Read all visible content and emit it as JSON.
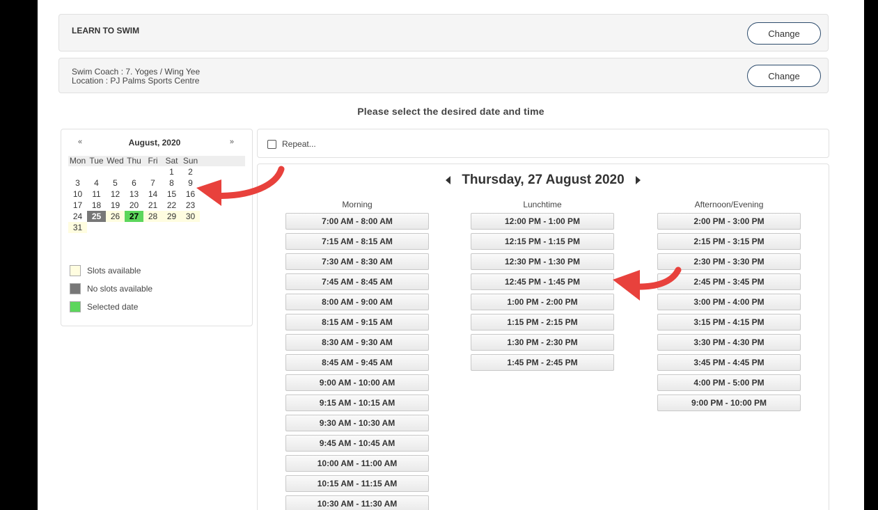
{
  "service": {
    "title": "LEARN TO SWIM",
    "change_label": "Change"
  },
  "coach": {
    "coach_line": "Swim Coach : 7. Yoges / Wing Yee",
    "location_line": "Location : PJ Palms Sports Centre",
    "change_label": "Change"
  },
  "prompt": "Please select the desired date and time",
  "calendar": {
    "prev": "«",
    "next": "»",
    "month": "August, 2020",
    "weekdays": [
      "Mon",
      "Tue",
      "Wed",
      "Thu",
      "Fri",
      "Sat",
      "Sun"
    ],
    "weeks": [
      [
        {
          "d": "",
          "s": ""
        },
        {
          "d": "",
          "s": ""
        },
        {
          "d": "",
          "s": ""
        },
        {
          "d": "",
          "s": ""
        },
        {
          "d": "",
          "s": ""
        },
        {
          "d": "1",
          "s": ""
        },
        {
          "d": "2",
          "s": ""
        }
      ],
      [
        {
          "d": "3",
          "s": ""
        },
        {
          "d": "4",
          "s": ""
        },
        {
          "d": "5",
          "s": ""
        },
        {
          "d": "6",
          "s": ""
        },
        {
          "d": "7",
          "s": ""
        },
        {
          "d": "8",
          "s": ""
        },
        {
          "d": "9",
          "s": ""
        }
      ],
      [
        {
          "d": "10",
          "s": ""
        },
        {
          "d": "11",
          "s": ""
        },
        {
          "d": "12",
          "s": ""
        },
        {
          "d": "13",
          "s": ""
        },
        {
          "d": "14",
          "s": ""
        },
        {
          "d": "15",
          "s": ""
        },
        {
          "d": "16",
          "s": ""
        }
      ],
      [
        {
          "d": "17",
          "s": ""
        },
        {
          "d": "18",
          "s": ""
        },
        {
          "d": "19",
          "s": ""
        },
        {
          "d": "20",
          "s": ""
        },
        {
          "d": "21",
          "s": ""
        },
        {
          "d": "22",
          "s": ""
        },
        {
          "d": "23",
          "s": ""
        }
      ],
      [
        {
          "d": "24",
          "s": ""
        },
        {
          "d": "25",
          "s": "none"
        },
        {
          "d": "26",
          "s": "avail"
        },
        {
          "d": "27",
          "s": "sel"
        },
        {
          "d": "28",
          "s": "avail"
        },
        {
          "d": "29",
          "s": "avail"
        },
        {
          "d": "30",
          "s": "avail"
        }
      ],
      [
        {
          "d": "31",
          "s": "avail"
        },
        {
          "d": "",
          "s": ""
        },
        {
          "d": "",
          "s": ""
        },
        {
          "d": "",
          "s": ""
        },
        {
          "d": "",
          "s": ""
        },
        {
          "d": "",
          "s": ""
        },
        {
          "d": "",
          "s": ""
        }
      ]
    ],
    "legend": [
      {
        "label": "Slots available",
        "color": "#fffde0"
      },
      {
        "label": "No slots available",
        "color": "#777777"
      },
      {
        "label": "Selected date",
        "color": "#5cd65c"
      }
    ]
  },
  "repeat": {
    "label": "Repeat..."
  },
  "day": {
    "title": "Thursday, 27 August 2020"
  },
  "columns": [
    {
      "heading": "Morning",
      "slots": [
        "7:00 AM - 8:00 AM",
        "7:15 AM - 8:15 AM",
        "7:30 AM - 8:30 AM",
        "7:45 AM - 8:45 AM",
        "8:00 AM - 9:00 AM",
        "8:15 AM - 9:15 AM",
        "8:30 AM - 9:30 AM",
        "8:45 AM - 9:45 AM",
        "9:00 AM - 10:00 AM",
        "9:15 AM - 10:15 AM",
        "9:30 AM - 10:30 AM",
        "9:45 AM - 10:45 AM",
        "10:00 AM - 11:00 AM",
        "10:15 AM - 11:15 AM",
        "10:30 AM - 11:30 AM"
      ]
    },
    {
      "heading": "Lunchtime",
      "slots": [
        "12:00 PM - 1:00 PM",
        "12:15 PM - 1:15 PM",
        "12:30 PM - 1:30 PM",
        "12:45 PM - 1:45 PM",
        "1:00 PM - 2:00 PM",
        "1:15 PM - 2:15 PM",
        "1:30 PM - 2:30 PM",
        "1:45 PM - 2:45 PM"
      ]
    },
    {
      "heading": "Afternoon/Evening",
      "slots": [
        "2:00 PM - 3:00 PM",
        "2:15 PM - 3:15 PM",
        "2:30 PM - 3:30 PM",
        "2:45 PM - 3:45 PM",
        "3:00 PM - 4:00 PM",
        "3:15 PM - 4:15 PM",
        "3:30 PM - 4:30 PM",
        "3:45 PM - 4:45 PM",
        "4:00 PM - 5:00 PM",
        "9:00 PM - 10:00 PM"
      ]
    }
  ],
  "colors": {
    "arrow": "#e8413c",
    "selected": "#5cd65c",
    "available": "#fffde0",
    "unavailable": "#777777"
  }
}
